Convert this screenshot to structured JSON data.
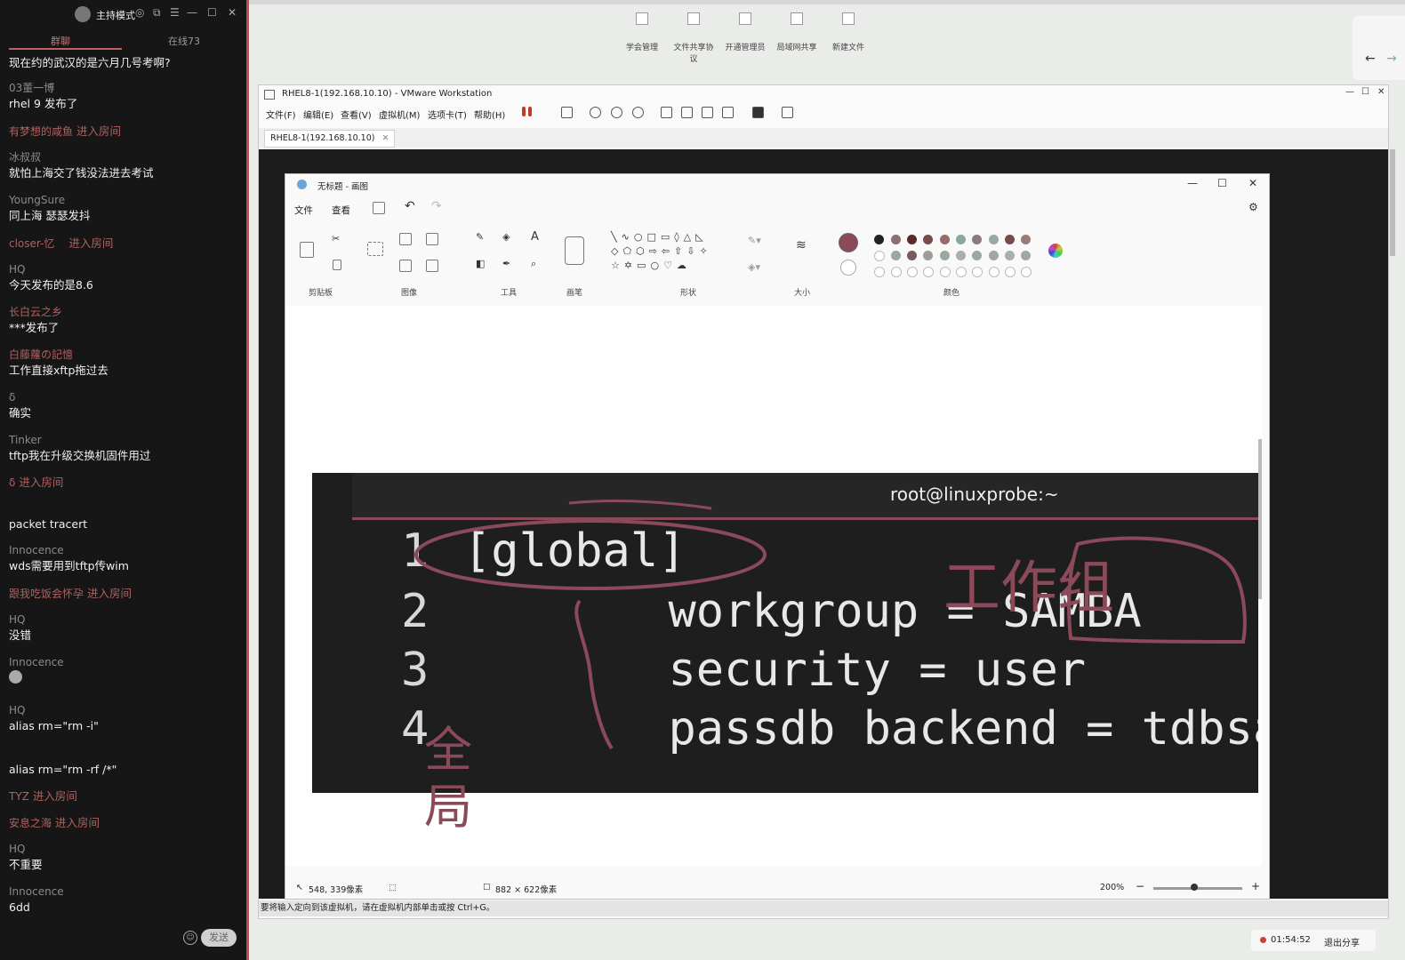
{
  "chat": {
    "host_mode": "主持模式",
    "tabs": [
      {
        "label": "群聊"
      },
      {
        "label": "在线73"
      }
    ],
    "messages": [
      {
        "nick": "",
        "text": "现在约的武汉的是六月几号考啊?"
      },
      {
        "nick": "03董一博",
        "text": "rhel 9 发布了"
      },
      {
        "nick": "有梦想的咸鱼",
        "text": "进入房间"
      },
      {
        "nick": "冰叔叔",
        "text": "就怕上海交了钱没法进去考试"
      },
      {
        "nick": "YoungSure",
        "text": "同上海  瑟瑟发抖"
      },
      {
        "nick": "closer-忆",
        "text": "进入房间"
      },
      {
        "nick": "HQ",
        "text": "今天发布的是8.6"
      },
      {
        "nick": "长白云之乡",
        "text": "***发布了"
      },
      {
        "nick": "白藤蘿の記憶",
        "text": "工作直接xftp拖过去"
      },
      {
        "nick": "δ",
        "text": "确实"
      },
      {
        "nick": "Tinker",
        "text": "tftp我在升级交换机固件用过"
      },
      {
        "nick": "δ",
        "text": "进入房间"
      },
      {
        "nick": "",
        "text": "packet tracert"
      },
      {
        "nick": "Innocence",
        "text": "wds需要用到tftp传wim"
      },
      {
        "nick": "跟我吃饭会怀孕",
        "text": "进入房间"
      },
      {
        "nick": "HQ",
        "text": "没错"
      },
      {
        "nick": "Innocence",
        "text": ""
      },
      {
        "nick": "HQ",
        "text": "alias rm=\"rm -i\""
      },
      {
        "nick": "",
        "text": "alias rm=\"rm -rf /*\""
      },
      {
        "nick": "TYZ",
        "text": "进入房间"
      },
      {
        "nick": "安息之海",
        "text": "进入房间"
      },
      {
        "nick": "HQ",
        "text": "不重要"
      },
      {
        "nick": "Innocence",
        "text": "6dd"
      }
    ],
    "send_label": "发送"
  },
  "desktop_icons": [
    {
      "label": "学会管理"
    },
    {
      "label": "文件共享协议"
    },
    {
      "label": "开通管理员"
    },
    {
      "label": "局域网共享"
    },
    {
      "label": "新建文件"
    }
  ],
  "vmware": {
    "title": "RHEL8-1(192.168.10.10) - VMware Workstation",
    "menus": [
      "文件(F)",
      "编辑(E)",
      "查看(V)",
      "虚拟机(M)",
      "选项卡(T)",
      "帮助(H)"
    ],
    "tab_label": "RHEL8-1(192.168.10.10)",
    "status_text": "要将输入定向到该虚拟机，请在虚拟机内部单击或按 Ctrl+G。"
  },
  "paint": {
    "title": "无标题 - 画图",
    "menus": [
      "文件",
      "查看"
    ],
    "groups": [
      "剪贴板",
      "图像",
      "工具",
      "画笔",
      "形状",
      "大小",
      "颜色"
    ],
    "status_position": "548, 339像素",
    "status_size": "882 × 622像素",
    "zoom": "200%"
  },
  "terminal": {
    "title": "root@linuxprobe:~",
    "lines": [
      {
        "num": "1",
        "code": "[global]"
      },
      {
        "num": "2",
        "code": "        workgroup = SAMBA"
      },
      {
        "num": "3",
        "code": "        security = user"
      },
      {
        "num": "4",
        "code": "        passdb backend = tdbsam"
      }
    ]
  },
  "annotations": {
    "heading": "工作组",
    "side": "全局"
  },
  "tray": {
    "time": "01:54:52",
    "exit_label": "退出分享"
  },
  "colors": {
    "annotation": "#8b4a5a",
    "chat_bg": "#161616",
    "accent": "#c06060"
  }
}
